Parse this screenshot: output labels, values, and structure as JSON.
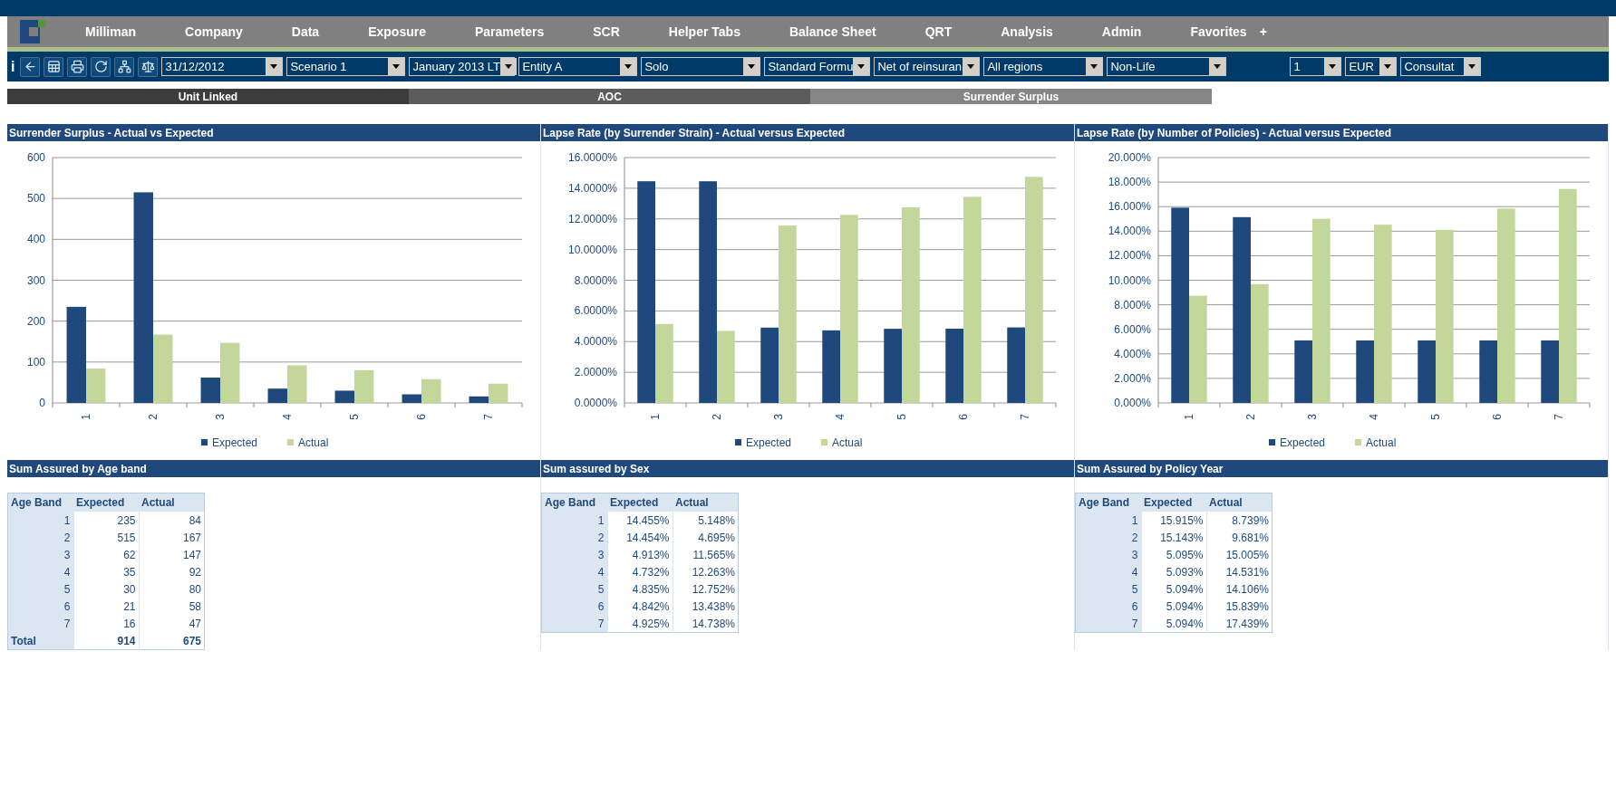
{
  "menu": {
    "items": [
      "Milliman",
      "Company",
      "Data",
      "Exposure",
      "Parameters",
      "SCR",
      "Helper Tabs",
      "Balance Sheet",
      "QRT",
      "Analysis",
      "Admin",
      "Favorites"
    ],
    "add_label": "+"
  },
  "toolbar": {
    "info_label": "i",
    "dropdowns": [
      {
        "value": "31/12/2012"
      },
      {
        "value": "Scenario 1"
      },
      {
        "value": "January 2013 LT"
      },
      {
        "value": "Entity A"
      },
      {
        "value": "Solo"
      },
      {
        "value": "Standard Formu"
      },
      {
        "value": "Net of reinsuran"
      },
      {
        "value": "All regions"
      },
      {
        "value": "Non-Life"
      },
      {
        "value": "1"
      },
      {
        "value": "EUR"
      },
      {
        "value": "Consultat"
      }
    ]
  },
  "tabs": [
    {
      "label": "Unit Linked",
      "selected": true
    },
    {
      "label": "AOC",
      "selected": false
    },
    {
      "label": "Surrender Surplus",
      "selected": false
    }
  ],
  "charts": [
    {
      "title": "Surrender Surplus - Actual vs Expected",
      "chart_data": {
        "type": "bar",
        "categories": [
          "1",
          "2",
          "3",
          "4",
          "5",
          "6",
          "7"
        ],
        "series": [
          {
            "name": "Expected",
            "color": "#1f497d",
            "values": [
              235,
              515,
              62,
              35,
              30,
              21,
              16
            ]
          },
          {
            "name": "Actual",
            "color": "#c4d79b",
            "values": [
              84,
              167,
              147,
              92,
              80,
              58,
              47
            ]
          }
        ],
        "grid": true,
        "legend": true,
        "ylim": [
          0,
          600
        ],
        "yticks": [
          0,
          100,
          200,
          300,
          400,
          500,
          600
        ]
      }
    },
    {
      "title": "Lapse Rate (by Surrender Strain) - Actual versus Expected",
      "chart_data": {
        "type": "bar",
        "categories": [
          "1",
          "2",
          "3",
          "4",
          "5",
          "6",
          "7"
        ],
        "series": [
          {
            "name": "Expected",
            "color": "#1f497d",
            "values": [
              14.455,
              14.454,
              4.913,
              4.732,
              4.835,
              4.842,
              4.925
            ]
          },
          {
            "name": "Actual",
            "color": "#c4d79b",
            "values": [
              5.148,
              4.695,
              11.565,
              12.263,
              12.752,
              13.438,
              14.738
            ]
          }
        ],
        "grid": true,
        "legend": true,
        "ylim": [
          0,
          16
        ],
        "yticks": [
          {
            "value": 0,
            "label": "0.0000%"
          },
          {
            "value": 2,
            "label": "2.0000%"
          },
          {
            "value": 4,
            "label": "4.0000%"
          },
          {
            "value": 6,
            "label": "6.0000%"
          },
          {
            "value": 8,
            "label": "8.0000%"
          },
          {
            "value": 10,
            "label": "10.0000%"
          },
          {
            "value": 12,
            "label": "12.0000%"
          },
          {
            "value": 14,
            "label": "14.0000%"
          },
          {
            "value": 16,
            "label": "16.0000%"
          }
        ]
      }
    },
    {
      "title": "Lapse Rate (by Number of Policies) - Actual versus Expected",
      "chart_data": {
        "type": "bar",
        "categories": [
          "1",
          "2",
          "3",
          "4",
          "5",
          "6",
          "7"
        ],
        "series": [
          {
            "name": "Expected",
            "color": "#1f497d",
            "values": [
              15.915,
              15.143,
              5.095,
              5.093,
              5.094,
              5.094,
              5.094
            ]
          },
          {
            "name": "Actual",
            "color": "#c4d79b",
            "values": [
              8.739,
              9.681,
              15.005,
              14.531,
              14.106,
              15.839,
              17.439
            ]
          }
        ],
        "grid": true,
        "legend": true,
        "ylim": [
          0,
          20
        ],
        "yticks": [
          {
            "value": 0,
            "label": "0.000%"
          },
          {
            "value": 2,
            "label": "2.000%"
          },
          {
            "value": 4,
            "label": "4.000%"
          },
          {
            "value": 6,
            "label": "6.000%"
          },
          {
            "value": 8,
            "label": "8.000%"
          },
          {
            "value": 10,
            "label": "10.000%"
          },
          {
            "value": 12,
            "label": "12.000%"
          },
          {
            "value": 14,
            "label": "14.000%"
          },
          {
            "value": 16,
            "label": "16.000%"
          },
          {
            "value": 18,
            "label": "18.000%"
          },
          {
            "value": 20,
            "label": "20.000%"
          }
        ]
      }
    }
  ],
  "tables": [
    {
      "title": "Sum Assured by Age band",
      "columns": [
        "Age Band",
        "Expected",
        "Actual"
      ],
      "rows": [
        [
          "1",
          "235",
          "84"
        ],
        [
          "2",
          "515",
          "167"
        ],
        [
          "3",
          "62",
          "147"
        ],
        [
          "4",
          "35",
          "92"
        ],
        [
          "5",
          "30",
          "80"
        ],
        [
          "6",
          "21",
          "58"
        ],
        [
          "7",
          "16",
          "47"
        ]
      ],
      "total": [
        "Total",
        "914",
        "675"
      ]
    },
    {
      "title": "Sum assured by Sex",
      "columns": [
        "Age Band",
        "Expected",
        "Actual"
      ],
      "rows": [
        [
          "1",
          "14.455%",
          "5.148%"
        ],
        [
          "2",
          "14.454%",
          "4.695%"
        ],
        [
          "3",
          "4.913%",
          "11.565%"
        ],
        [
          "4",
          "4.732%",
          "12.263%"
        ],
        [
          "5",
          "4.835%",
          "12.752%"
        ],
        [
          "6",
          "4.842%",
          "13.438%"
        ],
        [
          "7",
          "4.925%",
          "14.738%"
        ]
      ]
    },
    {
      "title": "Sum Assured by Policy Year",
      "columns": [
        "Age Band",
        "Expected",
        "Actual"
      ],
      "rows": [
        [
          "1",
          "15.915%",
          "8.739%"
        ],
        [
          "2",
          "15.143%",
          "9.681%"
        ],
        [
          "3",
          "5.095%",
          "15.005%"
        ],
        [
          "4",
          "5.093%",
          "14.531%"
        ],
        [
          "5",
          "5.094%",
          "14.106%"
        ],
        [
          "6",
          "5.094%",
          "15.839%"
        ],
        [
          "7",
          "5.094%",
          "17.439%"
        ]
      ]
    }
  ]
}
